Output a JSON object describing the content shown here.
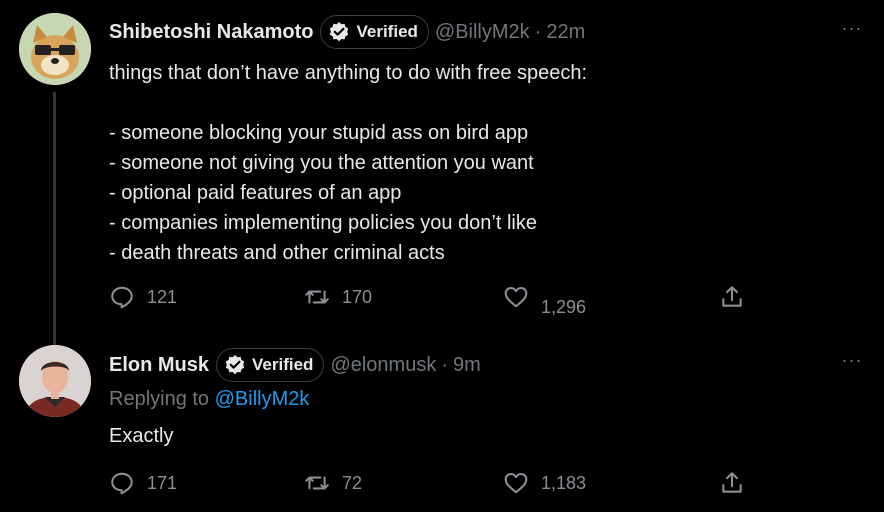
{
  "tweets": [
    {
      "name": "Shibetoshi Nakamoto",
      "badge": "Verified",
      "handle": "@BillyM2k",
      "separator": "·",
      "time": "22m",
      "text": "things that don’t have anything to do with free speech:\n\n- someone blocking your stupid ass on bird app\n- someone not giving you the attention you want\n- optional paid features of an app\n- companies implementing policies you don’t like\n- death threats and other criminal acts",
      "replies": "121",
      "retweets": "170",
      "likes": "1,296",
      "more": "···"
    },
    {
      "name": "Elon Musk",
      "badge": "Verified",
      "handle": "@elonmusk",
      "separator": "·",
      "time": "9m",
      "replying_prefix": "Replying to",
      "replying_to": "@BillyM2k",
      "text": "Exactly",
      "replies": "171",
      "retweets": "72",
      "likes": "1,183",
      "more": "···"
    }
  ],
  "colors": {
    "background": "#000000",
    "primary_text": "#e7e9ea",
    "secondary_text": "#71767b",
    "link": "#1d9bf0"
  },
  "icons": {
    "reply": "reply-icon",
    "retweet": "retweet-icon",
    "like": "heart-icon",
    "share": "share-icon",
    "verified": "verified-check-icon",
    "more": "more-icon"
  }
}
